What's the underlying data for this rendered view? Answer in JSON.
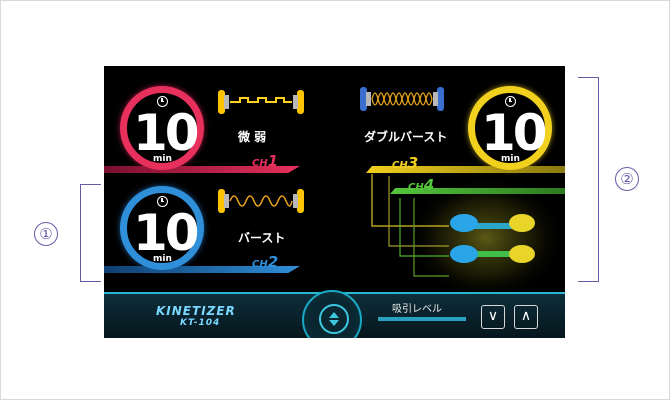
{
  "annotations": {
    "label_1": "①",
    "label_2": "②"
  },
  "channels": {
    "ch1": {
      "minutes": "10",
      "unit": "min",
      "mode": "微 弱",
      "prefix": "CH",
      "num": "1",
      "color": "#e8305d"
    },
    "ch2": {
      "minutes": "10",
      "unit": "min",
      "mode": "バースト",
      "prefix": "CH",
      "num": "2",
      "color": "#2f8fd8"
    },
    "ch3": {
      "minutes": "10",
      "unit": "min",
      "mode": "ダブルバースト",
      "prefix": "CH",
      "num": "3",
      "color": "#f2d01e"
    },
    "ch4": {
      "prefix": "CH",
      "num": "4",
      "color": "#54c63c"
    }
  },
  "footer": {
    "brand": "KINETIZER",
    "model": "KT-104",
    "suction_label": "吸引レベル",
    "down_glyph": "∨",
    "up_glyph": "∧"
  },
  "icons": {
    "timer": "clock-icon",
    "cycle": "up-down-arrows-icon",
    "waveforms": [
      "pulse-wave-icon",
      "sine-wave-icon",
      "double-burst-wave-icon"
    ]
  }
}
